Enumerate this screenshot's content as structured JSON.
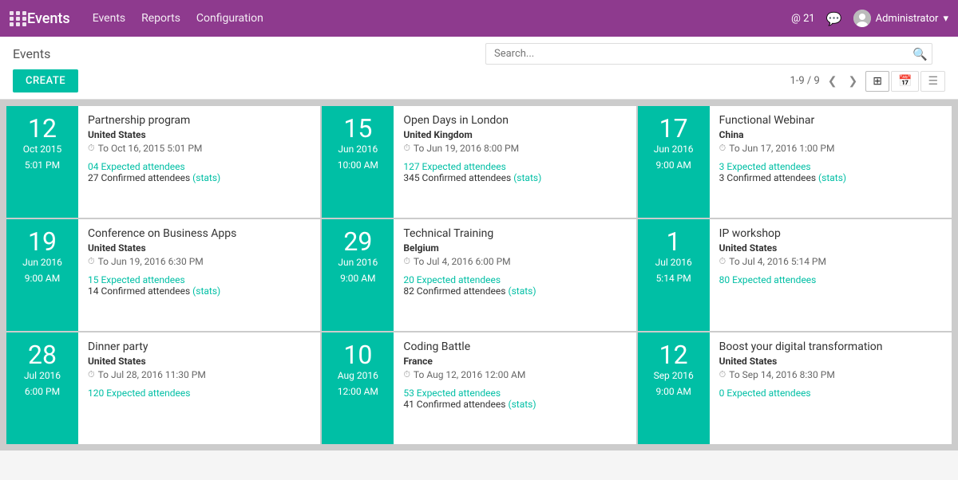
{
  "app": {
    "title": "Events",
    "nav_links": [
      "Events",
      "Reports",
      "Configuration"
    ],
    "badge": "@ 21",
    "user": "Administrator"
  },
  "header": {
    "page_title": "Events",
    "search_placeholder": "Search...",
    "create_label": "CREATE",
    "pager": "1-9 / 9"
  },
  "events": [
    {
      "day": "12",
      "month_year": "Oct 2015",
      "time": "5:01 PM",
      "name": "Partnership program",
      "country": "United States",
      "end_date": "To Oct 16, 2015 5:01 PM",
      "expected": "04 Expected attendees",
      "confirmed": "27 Confirmed attendees",
      "has_stats": true
    },
    {
      "day": "15",
      "month_year": "Jun 2016",
      "time": "10:00 AM",
      "name": "Open Days in London",
      "country": "United Kingdom",
      "end_date": "To Jun 19, 2016 8:00 PM",
      "expected": "127 Expected attendees",
      "confirmed": "345 Confirmed attendees",
      "has_stats": true
    },
    {
      "day": "17",
      "month_year": "Jun 2016",
      "time": "9:00 AM",
      "name": "Functional Webinar",
      "country": "China",
      "end_date": "To Jun 17, 2016 1:00 PM",
      "expected": "3 Expected attendees",
      "confirmed": "3 Confirmed attendees",
      "has_stats": true
    },
    {
      "day": "19",
      "month_year": "Jun 2016",
      "time": "9:00 AM",
      "name": "Conference on Business Apps",
      "country": "United States",
      "end_date": "To Jun 19, 2016 6:30 PM",
      "expected": "15 Expected attendees",
      "confirmed": "14 Confirmed attendees",
      "has_stats": true
    },
    {
      "day": "29",
      "month_year": "Jun 2016",
      "time": "9:00 AM",
      "name": "Technical Training",
      "country": "Belgium",
      "end_date": "To Jul 4, 2016 6:00 PM",
      "expected": "20 Expected attendees",
      "confirmed": "82 Confirmed attendees",
      "has_stats": true
    },
    {
      "day": "1",
      "month_year": "Jul 2016",
      "time": "5:14 PM",
      "name": "IP workshop",
      "country": "United States",
      "end_date": "To Jul 4, 2016 5:14 PM",
      "expected": "80 Expected attendees",
      "confirmed": null,
      "has_stats": false
    },
    {
      "day": "28",
      "month_year": "Jul 2016",
      "time": "6:00 PM",
      "name": "Dinner party",
      "country": "United States",
      "end_date": "To Jul 28, 2016 11:30 PM",
      "expected": "120 Expected attendees",
      "confirmed": null,
      "has_stats": false
    },
    {
      "day": "10",
      "month_year": "Aug 2016",
      "time": "12:00 AM",
      "name": "Coding Battle",
      "country": "France",
      "end_date": "To Aug 12, 2016 12:00 AM",
      "expected": "53 Expected attendees",
      "confirmed": "41 Confirmed attendees",
      "has_stats": true
    },
    {
      "day": "12",
      "month_year": "Sep 2016",
      "time": "9:00 AM",
      "name": "Boost your digital transformation",
      "country": "United States",
      "end_date": "To Sep 14, 2016 8:30 PM",
      "expected": "0 Expected attendees",
      "confirmed": null,
      "has_stats": false
    }
  ]
}
